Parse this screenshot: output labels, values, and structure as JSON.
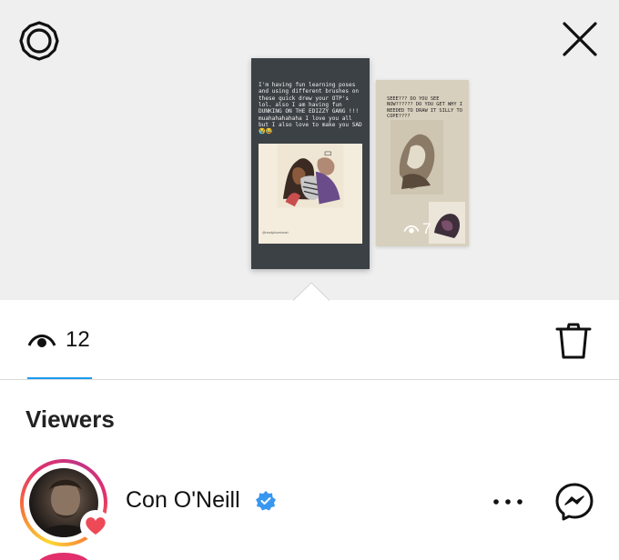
{
  "top": {
    "settings_icon": "gear-icon",
    "close_icon": "close-icon"
  },
  "stories": [
    {
      "caption": "I'm having fun learning poses and using different brushes on these quick drew your OTP's lol. also I am having fun DUNKING ON THE EDIZZY GANG !!! muahahahahaha I love you all but I also love to make you SAD 😭😂",
      "credit": "@readybluesheart",
      "views": "12",
      "selected": true
    },
    {
      "caption": "SEEE??? DO YOU SEE NOW?????? DO YOU GET WHY I NEEDED TO DRAW IT SILLY TO COPE????",
      "views": "7",
      "selected": false
    }
  ],
  "stats": {
    "view_count": "12",
    "eye_icon": "eye-icon",
    "delete_icon": "trash-icon"
  },
  "viewers": {
    "heading": "Viewers",
    "list": [
      {
        "name": "Con O'Neill",
        "verified": true,
        "liked": true
      }
    ]
  },
  "colors": {
    "accent": "#1d9bf0",
    "verified": "#3897f0",
    "heart": "#ed4956",
    "background_top": "#efefef"
  }
}
